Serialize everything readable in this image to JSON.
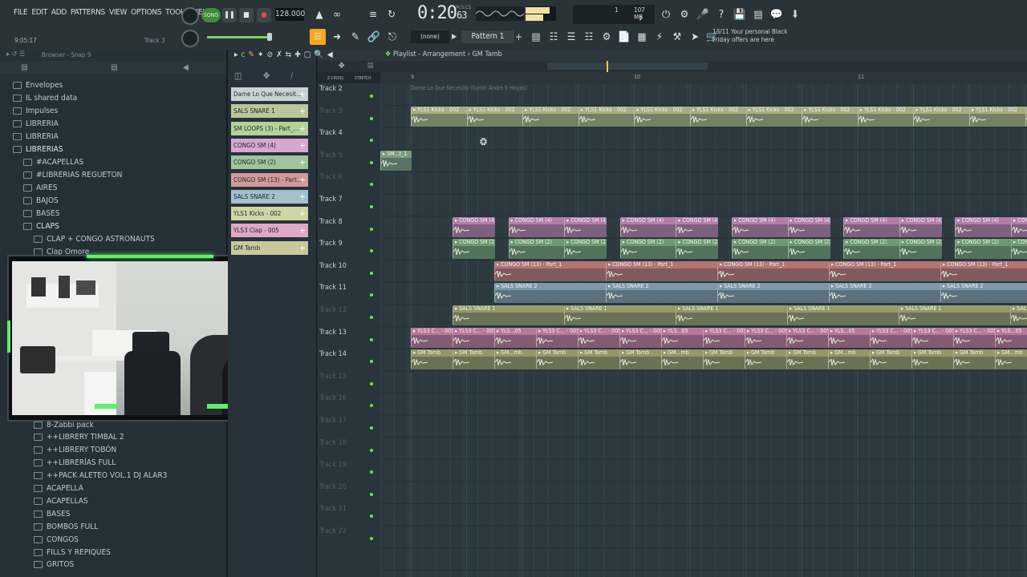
{
  "menu": [
    "FILE",
    "EDIT",
    "ADD",
    "PATTERNS",
    "VIEW",
    "OPTIONS",
    "TOOLS",
    "HELP"
  ],
  "hint": {
    "time": "9:05:17",
    "track": "Track 3"
  },
  "transport": {
    "song_label": "SONG",
    "tempo": "128.000",
    "time_main": "0:20",
    "time_sub": "63",
    "time_unit": "M:S:CS"
  },
  "memory": {
    "value": "107 MB",
    "line1": "1",
    "line2": "7"
  },
  "snap": "(none)",
  "pattern": "Pattern 1",
  "news": {
    "line1": "13/11  Your personal Black",
    "line2": "Friday offers are here"
  },
  "browser": {
    "title": "Browser - Snap 9",
    "items": [
      {
        "label": "Envelopes",
        "indent": 0
      },
      {
        "label": "IL shared data",
        "indent": 0
      },
      {
        "label": "Impulses",
        "indent": 0
      },
      {
        "label": "LIBRERIA",
        "indent": 0
      },
      {
        "label": "LIBRERIA",
        "indent": 0
      },
      {
        "label": "LIBRERIAS",
        "indent": 0
      },
      {
        "label": "#ACAPELLAS",
        "indent": 1
      },
      {
        "label": "#LIBRERIAS REGUETON",
        "indent": 1
      },
      {
        "label": "AIRES",
        "indent": 1
      },
      {
        "label": "BAJOS",
        "indent": 1
      },
      {
        "label": "BASES",
        "indent": 1
      },
      {
        "label": "CLAPS",
        "indent": 1
      },
      {
        "label": "CLAP + CONGO ASTRONAUTS",
        "indent": 2
      },
      {
        "label": "Clap Omore",
        "indent": 2
      }
    ],
    "items_lower": [
      {
        "label": "8-Zabbi pack"
      },
      {
        "label": "++LIBRERY TIMBAL 2"
      },
      {
        "label": "++LIBRERY TOBÓN"
      },
      {
        "label": "++LIBRERÍAS FULL"
      },
      {
        "label": "++PACK ALETEO VOL.1 DJ ALAR3"
      },
      {
        "label": "ACAPELLA"
      },
      {
        "label": "ACAPELLAS"
      },
      {
        "label": "BASES"
      },
      {
        "label": "BOMBOS FULL"
      },
      {
        "label": "CONGOS"
      },
      {
        "label": "FILLS Y REPIQUES"
      },
      {
        "label": "GRITOS"
      }
    ]
  },
  "rack": [
    {
      "label": "Dame Lo Que Necesit...",
      "color": "#c9d3d6"
    },
    {
      "label": "SALS SNARE 1",
      "color": "#b9c79a"
    },
    {
      "label": "SM LOOPS (3) - Part_...",
      "color": "#b3d29a"
    },
    {
      "label": "CONGO SM (4)",
      "color": "#d8a6cf"
    },
    {
      "label": "CONGO SM (2)",
      "color": "#9ec59b"
    },
    {
      "label": "CONGO SM (13) - Part...",
      "color": "#d49a9a"
    },
    {
      "label": "SALS SNARE 2",
      "color": "#a5c0cd"
    },
    {
      "label": "YLS1 Kicks - 002",
      "color": "#cfd6a4"
    },
    {
      "label": "YLS3 Clap - 005",
      "color": "#e0a7c6"
    },
    {
      "label": "GM Tamb",
      "color": "#c7c99a"
    }
  ],
  "playlist": {
    "title": "Playlist - Arrangement",
    "pattern": "GM Tamb",
    "bars": [
      "9",
      "10",
      "11"
    ],
    "top_clip": "Dame Lo Que Necesito (Synth Andre E Hoyos)",
    "tracks": [
      "Track 2",
      "Track 3",
      "Track 4",
      "Track 5",
      "Track 6",
      "Track 7",
      "Track 8",
      "Track 9",
      "Track 10",
      "Track 11",
      "Track 12",
      "Track 13",
      "Track 14",
      "Track 15",
      "Track 16",
      "Track 17",
      "Track 18",
      "Track 19",
      "Track 20",
      "Track 21",
      "Track 22"
    ],
    "clip_names": {
      "kicks": "YLS1 Kicks - 002",
      "sm": "SM...t_1",
      "congo4": "CONGO SM (4)",
      "congo2": "CONGO SM (2)",
      "congo13": "CONGO SM (13) - Part_1",
      "snare2": "SALS SNARE 2",
      "snare1": "SALS SNARE 1",
      "clap": "YLS3 C... - 005",
      "clap_short": "YLS...05",
      "tamb": "GM Tamb",
      "tamb_short": "GM...mb"
    }
  },
  "colors": {
    "kicks": "#a6ae7f",
    "congo4": "#b37daa",
    "congo2": "#6f9a70",
    "congo13": "#b57373",
    "snare2": "#7d99a8",
    "snare1": "#94986a",
    "clap": "#b97799",
    "tamb": "#959766",
    "sm": "#7b9a80"
  }
}
